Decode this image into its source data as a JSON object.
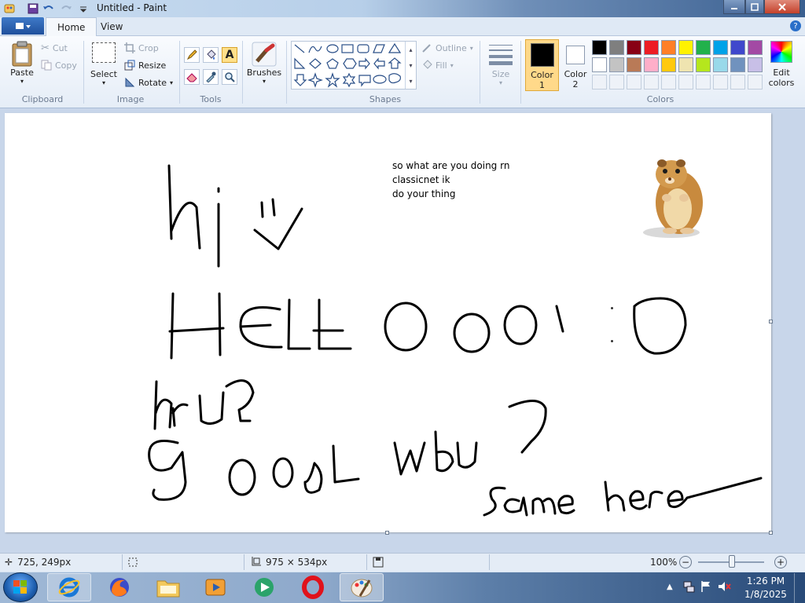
{
  "window": {
    "title": "Untitled - Paint"
  },
  "ribbon": {
    "tabs": [
      "Home",
      "View"
    ],
    "clipboard": {
      "label": "Clipboard",
      "paste": "Paste",
      "cut": "Cut",
      "copy": "Copy"
    },
    "image": {
      "label": "Image",
      "select": "Select",
      "crop": "Crop",
      "resize": "Resize",
      "rotate": "Rotate"
    },
    "tools": {
      "label": "Tools"
    },
    "brushes": {
      "label": "Brushes"
    },
    "shapes": {
      "label": "Shapes",
      "outline": "Outline",
      "fill": "Fill"
    },
    "size": {
      "label": "Size"
    },
    "color1": {
      "label": "Color",
      "num": "1",
      "value": "#000000"
    },
    "color2": {
      "label": "Color",
      "num": "2",
      "value": "#ffffff"
    },
    "colors": {
      "label": "Colors",
      "edit_line1": "Edit",
      "edit_line2": "colors",
      "row1": [
        "#000000",
        "#7f7f7f",
        "#880015",
        "#ed1c24",
        "#ff7f27",
        "#fff200",
        "#22b14c",
        "#00a2e8",
        "#3f48cc",
        "#a349a4"
      ],
      "row2": [
        "#ffffff",
        "#c3c3c3",
        "#b97a57",
        "#ffaec9",
        "#ffc90e",
        "#efe4b0",
        "#b5e61d",
        "#99d9ea",
        "#7092be",
        "#c8bfe7"
      ],
      "row3": [
        "#eef2f8",
        "#eef2f8",
        "#eef2f8",
        "#eef2f8",
        "#eef2f8",
        "#eef2f8",
        "#eef2f8",
        "#eef2f8",
        "#eef2f8",
        "#eef2f8"
      ]
    }
  },
  "canvas": {
    "text_lines": [
      "so what are you doing rn",
      "classicnet ik",
      "do your thing"
    ]
  },
  "status": {
    "cursor_pos": "725, 249px",
    "canvas_size": "975 × 534px",
    "zoom": "100%"
  },
  "taskbar": {
    "time": "1:26 PM",
    "date": "1/8/2025"
  }
}
